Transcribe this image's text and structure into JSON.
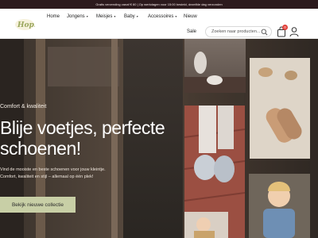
{
  "topbar": {
    "text": "Gratis verzending vanaf € 60 | Op werkdagen voor 15:00 besteld, dezelfde dag verzonden"
  },
  "brand": {
    "logo_text": "Hop!",
    "accent": "#c8cfa6"
  },
  "nav": {
    "items": [
      {
        "label": "Home",
        "has_dropdown": false
      },
      {
        "label": "Jongens",
        "has_dropdown": true
      },
      {
        "label": "Meisjes",
        "has_dropdown": true
      },
      {
        "label": "Baby",
        "has_dropdown": true
      },
      {
        "label": "Accessoires",
        "has_dropdown": true
      },
      {
        "label": "Nieuw",
        "has_dropdown": false
      },
      {
        "label": "Sale",
        "has_dropdown": false
      }
    ],
    "dropdown_caret": "▾"
  },
  "search": {
    "placeholder": "Zoeken naar producten...",
    "icon": "search-icon"
  },
  "cart": {
    "count": "0",
    "icon": "shopping-bag-icon"
  },
  "account": {
    "icon": "user-icon"
  },
  "hero": {
    "eyebrow": "Comfort & kwaliteit",
    "title": "Blije voetjes, perfecte schoenen!",
    "subtitle": "Vind de mooiste en beste schoenen voor jouw kleintje. Comfort, kwaliteit en stijl – allemaal op één plek!",
    "cta": "Bekijk nieuwe collectie"
  },
  "colors": {
    "topbar_bg": "#2c1a1d",
    "cta_bg": "#c8cfa6",
    "badge": "#e0403a"
  }
}
